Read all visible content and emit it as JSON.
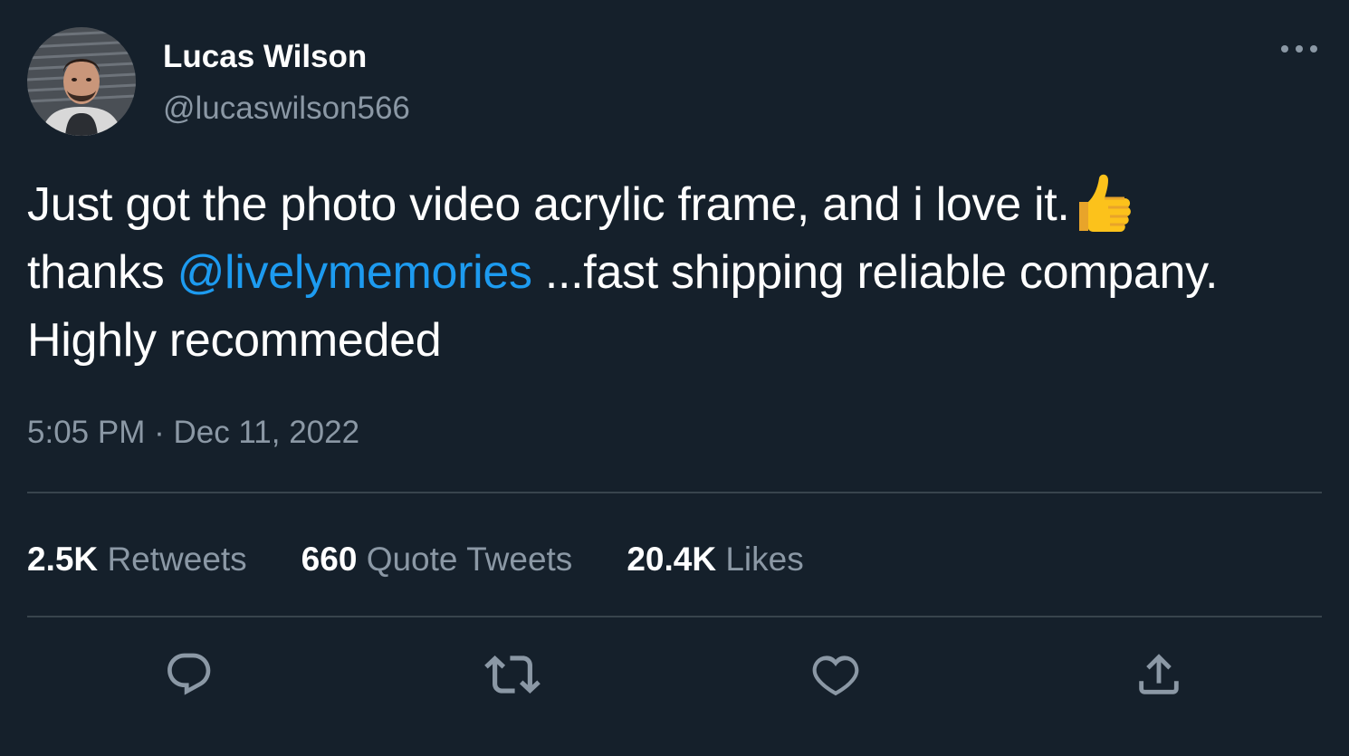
{
  "author": {
    "display_name": "Lucas Wilson",
    "handle": "@lucaswilson566",
    "avatar_icon": "profile-photo"
  },
  "tweet": {
    "text_part1": "Just got the photo video acrylic frame, and i love it.",
    "emoji": "thumbs-up",
    "text_part2": "thanks ",
    "mention": "@livelymemories",
    "text_part3": " ...fast shipping reliable company. Highly recommeded",
    "timestamp": "5:05 PM · Dec 11, 2022"
  },
  "stats": {
    "retweets_count": "2.5K",
    "retweets_label": "Retweets",
    "quotes_count": "660",
    "quotes_label": "Quote Tweets",
    "likes_count": "20.4K",
    "likes_label": "Likes"
  },
  "actions": [
    {
      "icon": "reply-icon"
    },
    {
      "icon": "retweet-icon"
    },
    {
      "icon": "like-icon"
    },
    {
      "icon": "share-icon"
    }
  ],
  "colors": {
    "background": "#15202b",
    "primary_text": "#ffffff",
    "secondary_text": "#8b98a5",
    "link": "#1d9bf0",
    "divider": "#38444d"
  }
}
